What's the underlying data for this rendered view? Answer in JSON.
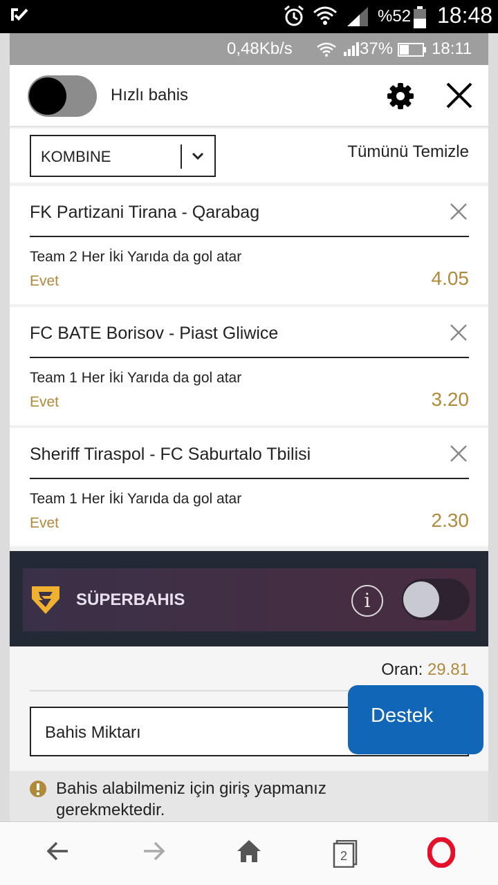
{
  "status_outer": {
    "battery_pct": "%52",
    "time": "18:48"
  },
  "status_inner": {
    "speed": "0,48Kb/s",
    "battery_pct": "37%",
    "time": "18:11"
  },
  "header": {
    "quick_bet_label": "Hızlı bahis",
    "quick_bet_on": false
  },
  "betslip": {
    "type_value": "KOMBINE",
    "clear_all": "Tümünü Temizle"
  },
  "bets": [
    {
      "match": "FK Partizani Tirana - Qarabag",
      "market": "Team 2 Her İki Yarıda da gol atar",
      "selection": "Evet",
      "odds": "4.05"
    },
    {
      "match": "FC BATE Borisov - Piast Gliwice",
      "market": "Team 1 Her İki Yarıda da gol atar",
      "selection": "Evet",
      "odds": "3.20"
    },
    {
      "match": "Sheriff Tiraspol - FC Saburtalo Tbilisi",
      "market": "Team 1 Her İki Yarıda da gol atar",
      "selection": "Evet",
      "odds": "2.30"
    }
  ],
  "superbet": {
    "label": "SÜPERBAHIS",
    "info_glyph": "i",
    "enabled": false
  },
  "summary": {
    "oran_label": "Oran:",
    "oran_value": "29.81",
    "stake_placeholder": "Bahis Miktarı"
  },
  "warning": {
    "text": "Bahis alabilmeniz için giriş yapmanız gerekmektedir."
  },
  "support": {
    "label": "Destek"
  },
  "browser_nav": {
    "tab_count": "2"
  },
  "colors": {
    "accent_gold": "#b08a3a",
    "support_blue": "#1266b8",
    "super_dark": "#232a36"
  }
}
